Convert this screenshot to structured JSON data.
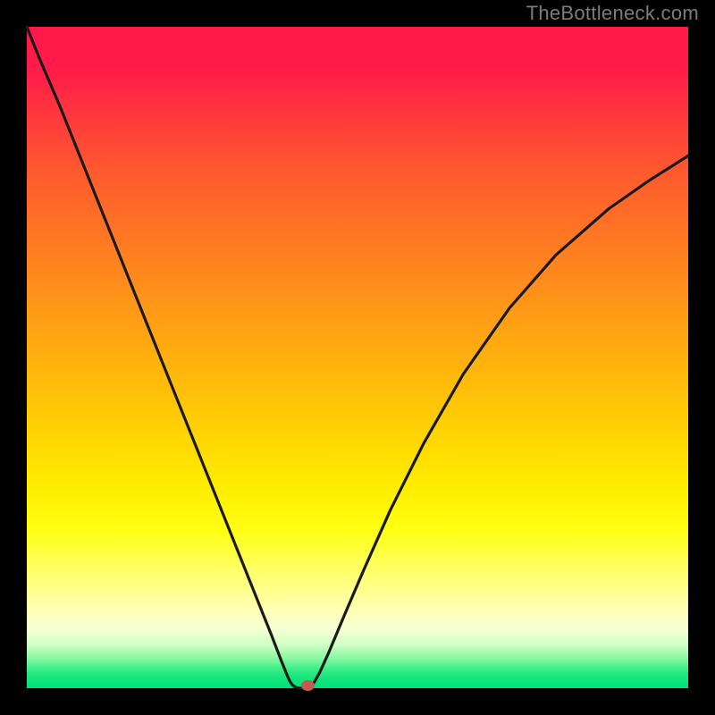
{
  "watermark": "TheBottleneck.com",
  "chart_data": {
    "type": "line",
    "title": "",
    "xlabel": "",
    "ylabel": "",
    "xlim": [
      0,
      100
    ],
    "ylim": [
      0,
      100
    ],
    "grid": false,
    "gradient_stops": [
      {
        "pos": 0.0,
        "color": "#ff1a4a"
      },
      {
        "pos": 0.7,
        "color": "#ffee00"
      },
      {
        "pos": 0.9,
        "color": "#ffffb0"
      },
      {
        "pos": 1.0,
        "color": "#00e276"
      }
    ],
    "series": [
      {
        "name": "left-branch",
        "x": [
          0,
          2,
          5,
          8,
          12,
          16,
          20,
          24,
          28,
          32,
          35,
          37,
          38.5,
          39.3,
          39.8,
          40.2,
          40.6,
          41.0
        ],
        "y": [
          100,
          95,
          88,
          80.5,
          70.5,
          60.5,
          50.5,
          40.5,
          30.5,
          20.5,
          13.0,
          8.0,
          4.1,
          2.1,
          1.0,
          0.45,
          0.18,
          0.0
        ]
      },
      {
        "name": "right-branch",
        "x": [
          42.8,
          43.4,
          44.3,
          45.7,
          48.0,
          51.0,
          55.0,
          60.0,
          66.0,
          73.0,
          80.0,
          88.0,
          94.0,
          100.0
        ],
        "y": [
          0.0,
          0.8,
          2.4,
          5.5,
          11.0,
          18.0,
          27.0,
          37.0,
          47.5,
          57.5,
          65.5,
          72.5,
          76.7,
          80.5
        ]
      },
      {
        "name": "minimum-flat",
        "x": [
          41.0,
          42.8
        ],
        "y": [
          0.0,
          0.0
        ]
      }
    ],
    "marker": {
      "x": 42.5,
      "y": 0.4,
      "name": "min-dot",
      "color": "#c35a52"
    }
  }
}
